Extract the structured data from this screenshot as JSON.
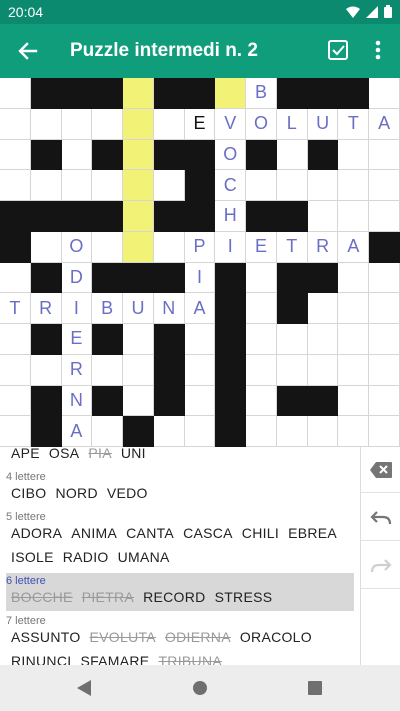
{
  "status_bar": {
    "time": "20:04"
  },
  "app_bar": {
    "title": "Puzzle intermedi n. 2",
    "icons": [
      "arrow-back-icon",
      "check-square-icon",
      "more-vert-icon"
    ]
  },
  "colors": {
    "status": "#0b8a6f",
    "primary": "#0f9d7c",
    "highlight": "#f2f277",
    "placed_letter": "#6a6fc4"
  },
  "grid": {
    "cols": 13,
    "rows": 12,
    "rows_data": [
      ".###X##*B###.",
      "....*.EVOLUTA",
      ".#.#*##O#.#..",
      "....*.#C.....",
      "####*##H##...",
      "#.O.*.PIETRA#",
      ".#D###I#.##..",
      "TRIBUNA#.#...",
      ".#E#.#.#.....",
      "..R..#.#.....",
      ".#N#.#.#.##..",
      ".#A.#..#....."
    ],
    "user_letters": [
      "E"
    ],
    "highlight_col": 4
  },
  "word_list": {
    "groups": [
      {
        "label": "",
        "words": [
          {
            "t": "APE",
            "used": false
          },
          {
            "t": "OSA",
            "used": false
          },
          {
            "t": "PIA",
            "used": true
          },
          {
            "t": "UNI",
            "used": false
          }
        ]
      },
      {
        "label": "4 lettere",
        "words": [
          {
            "t": "CIBO",
            "used": false
          },
          {
            "t": "NORD",
            "used": false
          },
          {
            "t": "VEDO",
            "used": false
          }
        ]
      },
      {
        "label": "5 lettere",
        "words": [
          {
            "t": "ADORA",
            "used": false
          },
          {
            "t": "ANIMA",
            "used": false
          },
          {
            "t": "CANTA",
            "used": false
          },
          {
            "t": "CASCA",
            "used": false
          },
          {
            "t": "CHILI",
            "used": false
          },
          {
            "t": "EBREA",
            "used": false
          }
        ]
      },
      {
        "label": "",
        "words": [
          {
            "t": "ISOLE",
            "used": false
          },
          {
            "t": "RADIO",
            "used": false
          },
          {
            "t": "UMANA",
            "used": false
          }
        ]
      },
      {
        "label": "6 lettere",
        "words": [
          {
            "t": "BOCCHE",
            "used": true
          },
          {
            "t": "PIETRA",
            "used": true
          },
          {
            "t": "RECORD",
            "used": false
          },
          {
            "t": "STRESS",
            "used": false
          }
        ]
      },
      {
        "label": "7 lettere",
        "words": [
          {
            "t": "ASSUNTO",
            "used": false
          },
          {
            "t": "EVOLUTA",
            "used": true
          },
          {
            "t": "ODIERNA",
            "used": true
          },
          {
            "t": "ORACOLO",
            "used": false
          }
        ]
      },
      {
        "label": "",
        "words": [
          {
            "t": "RINUNCI",
            "used": false
          },
          {
            "t": "SFAMARE",
            "used": false
          },
          {
            "t": "TRIBUNA",
            "used": true
          }
        ]
      }
    ],
    "selected_group": 4
  },
  "side_panel": {
    "icons": [
      "backspace-icon",
      "undo-icon",
      "redo-icon"
    ]
  },
  "nav_bar": {
    "icons": [
      "nav-back-icon",
      "nav-home-icon",
      "nav-recents-icon"
    ]
  }
}
